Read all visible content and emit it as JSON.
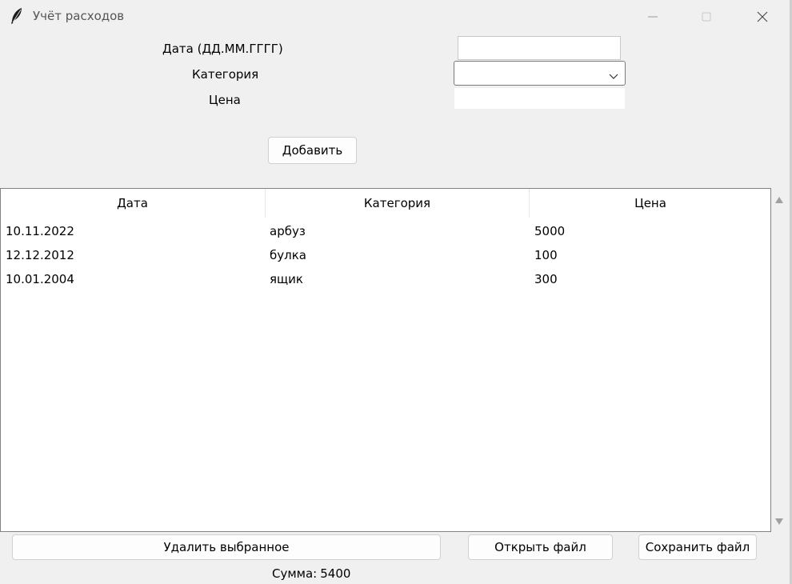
{
  "window": {
    "title": "Учёт расходов",
    "icons": {
      "app": "feather-icon",
      "minimize": "minimize-icon",
      "maximize": "maximize-icon",
      "close": "close-icon"
    }
  },
  "form": {
    "date_label": "Дата (ДД.ММ.ГГГГ)",
    "category_label": "Категория",
    "price_label": "Цена",
    "date_value": "",
    "category_value": "",
    "price_value": "",
    "add_button": "Добавить"
  },
  "table": {
    "columns": [
      "Дата",
      "Категория",
      "Цена"
    ],
    "rows": [
      [
        "10.11.2022",
        "арбуз",
        "5000"
      ],
      [
        "12.12.2012",
        "булка",
        "100"
      ],
      [
        "10.01.2004",
        "ящик",
        "300"
      ]
    ]
  },
  "actions": {
    "delete_button": "Удалить выбранное",
    "open_button": "Открыть файл",
    "save_button": "Сохранить файл"
  },
  "total": {
    "label": "Сумма:",
    "value": "5400"
  }
}
